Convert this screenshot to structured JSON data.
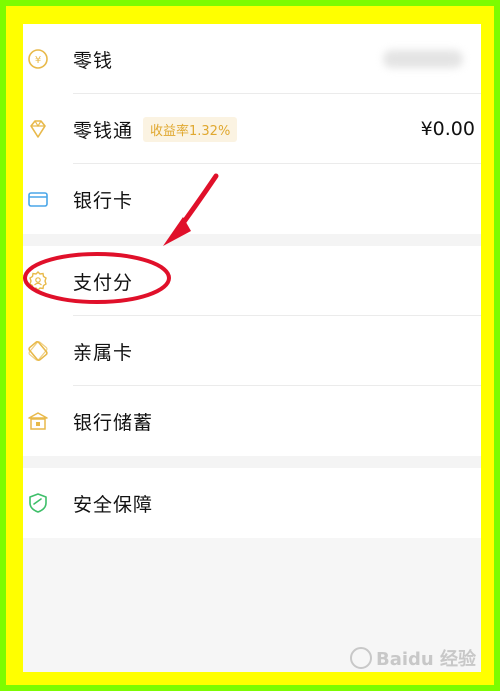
{
  "wallet": {
    "items": [
      {
        "label": "零钱",
        "icon": "coin-icon"
      },
      {
        "label": "零钱通",
        "badge": "收益率1.32%",
        "value": "¥0.00",
        "icon": "diamond-icon"
      },
      {
        "label": "银行卡",
        "icon": "bank-card-icon"
      },
      {
        "label": "支付分",
        "icon": "payscore-badge-icon"
      },
      {
        "label": "亲属卡",
        "icon": "family-card-icon"
      },
      {
        "label": "银行储蓄",
        "icon": "bank-savings-icon"
      },
      {
        "label": "安全保障",
        "icon": "shield-icon"
      }
    ]
  },
  "watermark": {
    "text": "Baidu 经验"
  },
  "colors": {
    "outer_border": "#7cfc00",
    "inner_border": "#ffff00",
    "gold_icon": "#e8b94a",
    "blue_icon": "#4aa6e8",
    "green_icon": "#3fbf6a",
    "badge_text": "#e0a830",
    "annotation_red": "#e0102a"
  }
}
